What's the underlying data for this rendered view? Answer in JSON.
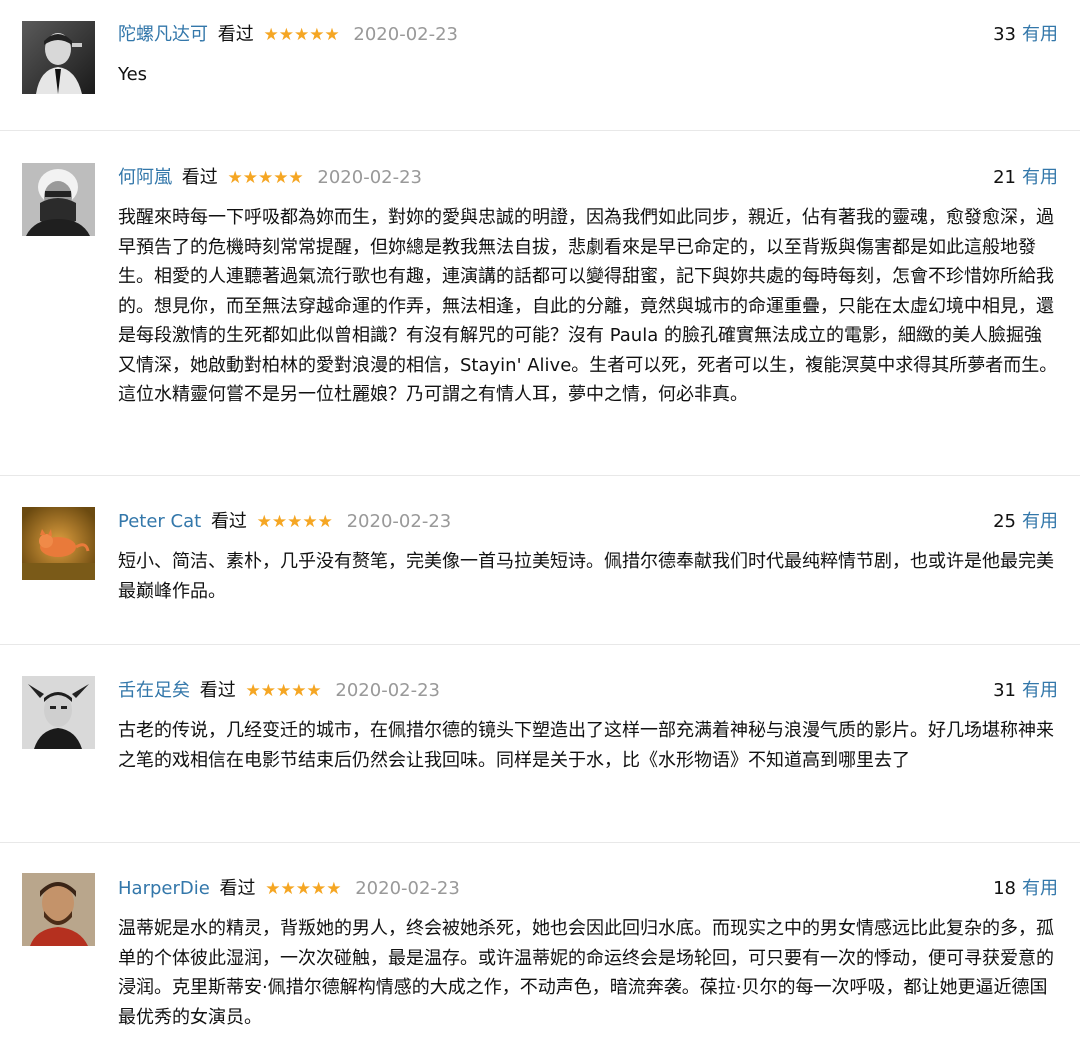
{
  "reviews": [
    {
      "author": "陀螺凡达可",
      "watched_label": "看过",
      "stars": "★★★★★",
      "date": "2020-02-23",
      "votes": "33",
      "useful_label": "有用",
      "content": "Yes",
      "avatar_icon": "user-avatar"
    },
    {
      "author": "何阿嵐",
      "watched_label": "看过",
      "stars": "★★★★★",
      "date": "2020-02-23",
      "votes": "21",
      "useful_label": "有用",
      "content": "我醒來時每一下呼吸都為妳而生，對妳的愛與忠誠的明證，因為我們如此同步，親近，佔有著我的靈魂，愈發愈深，過早預告了的危機時刻常常提醒，但妳總是教我無法自拔，悲劇看來是早已命定的，以至背叛與傷害都是如此這般地發生。相愛的人連聽著過氣流行歌也有趣，連演講的話都可以變得甜蜜，記下與妳共處的每時每刻，怎會不珍惜妳所給我的。想見你，而至無法穿越命運的作弄，無法相逢，自此的分離，竟然與城市的命運重疊，只能在太虛幻境中相見，還是每段激情的生死都如此似曾相識？有沒有解咒的可能？沒有 Paula 的臉孔確實無法成立的電影，細緻的美人臉掘強又情深，她啟動對柏林的愛對浪漫的相信，Stayin' Alive。生者可以死，死者可以生，複能溟莫中求得其所夢者而生。這位水精靈何嘗不是另一位杜麗娘？乃可謂之有情人耳，夢中之情，何必非真。",
      "avatar_icon": "user-avatar"
    },
    {
      "author": "Peter Cat",
      "watched_label": "看过",
      "stars": "★★★★★",
      "date": "2020-02-23",
      "votes": "25",
      "useful_label": "有用",
      "content": "短小、简洁、素朴，几乎没有赘笔，完美像一首马拉美短诗。佩措尔德奉献我们时代最纯粹情节剧，也或许是他最完美最巅峰作品。",
      "avatar_icon": "user-avatar"
    },
    {
      "author": "舌在足矣",
      "watched_label": "看过",
      "stars": "★★★★★",
      "date": "2020-02-23",
      "votes": "31",
      "useful_label": "有用",
      "content": "古老的传说，几经变迁的城市，在佩措尔德的镜头下塑造出了这样一部充满着神秘与浪漫气质的影片。好几场堪称神来之笔的戏相信在电影节结束后仍然会让我回味。同样是关于水，比《水形物语》不知道高到哪里去了",
      "avatar_icon": "user-avatar"
    },
    {
      "author": "HarperDie",
      "watched_label": "看过",
      "stars": "★★★★★",
      "date": "2020-02-23",
      "votes": "18",
      "useful_label": "有用",
      "content": "温蒂妮是水的精灵，背叛她的男人，终会被她杀死，她也会因此回归水底。而现实之中的男女情感远比此复杂的多，孤单的个体彼此湿润，一次次碰触，最是温存。或许温蒂妮的命运终会是场轮回，可只要有一次的悸动，便可寻获爱意的浸润。克里斯蒂安·佩措尔德解构情感的大成之作，不动声色，暗流奔袭。葆拉·贝尔的每一次呼吸，都让她更逼近德国最优秀的女演员。",
      "avatar_icon": "user-avatar"
    }
  ],
  "colors": {
    "link": "#3377aa",
    "star": "#f5a623",
    "date": "#999999",
    "text": "#111111",
    "divider": "#e8e8e8"
  }
}
